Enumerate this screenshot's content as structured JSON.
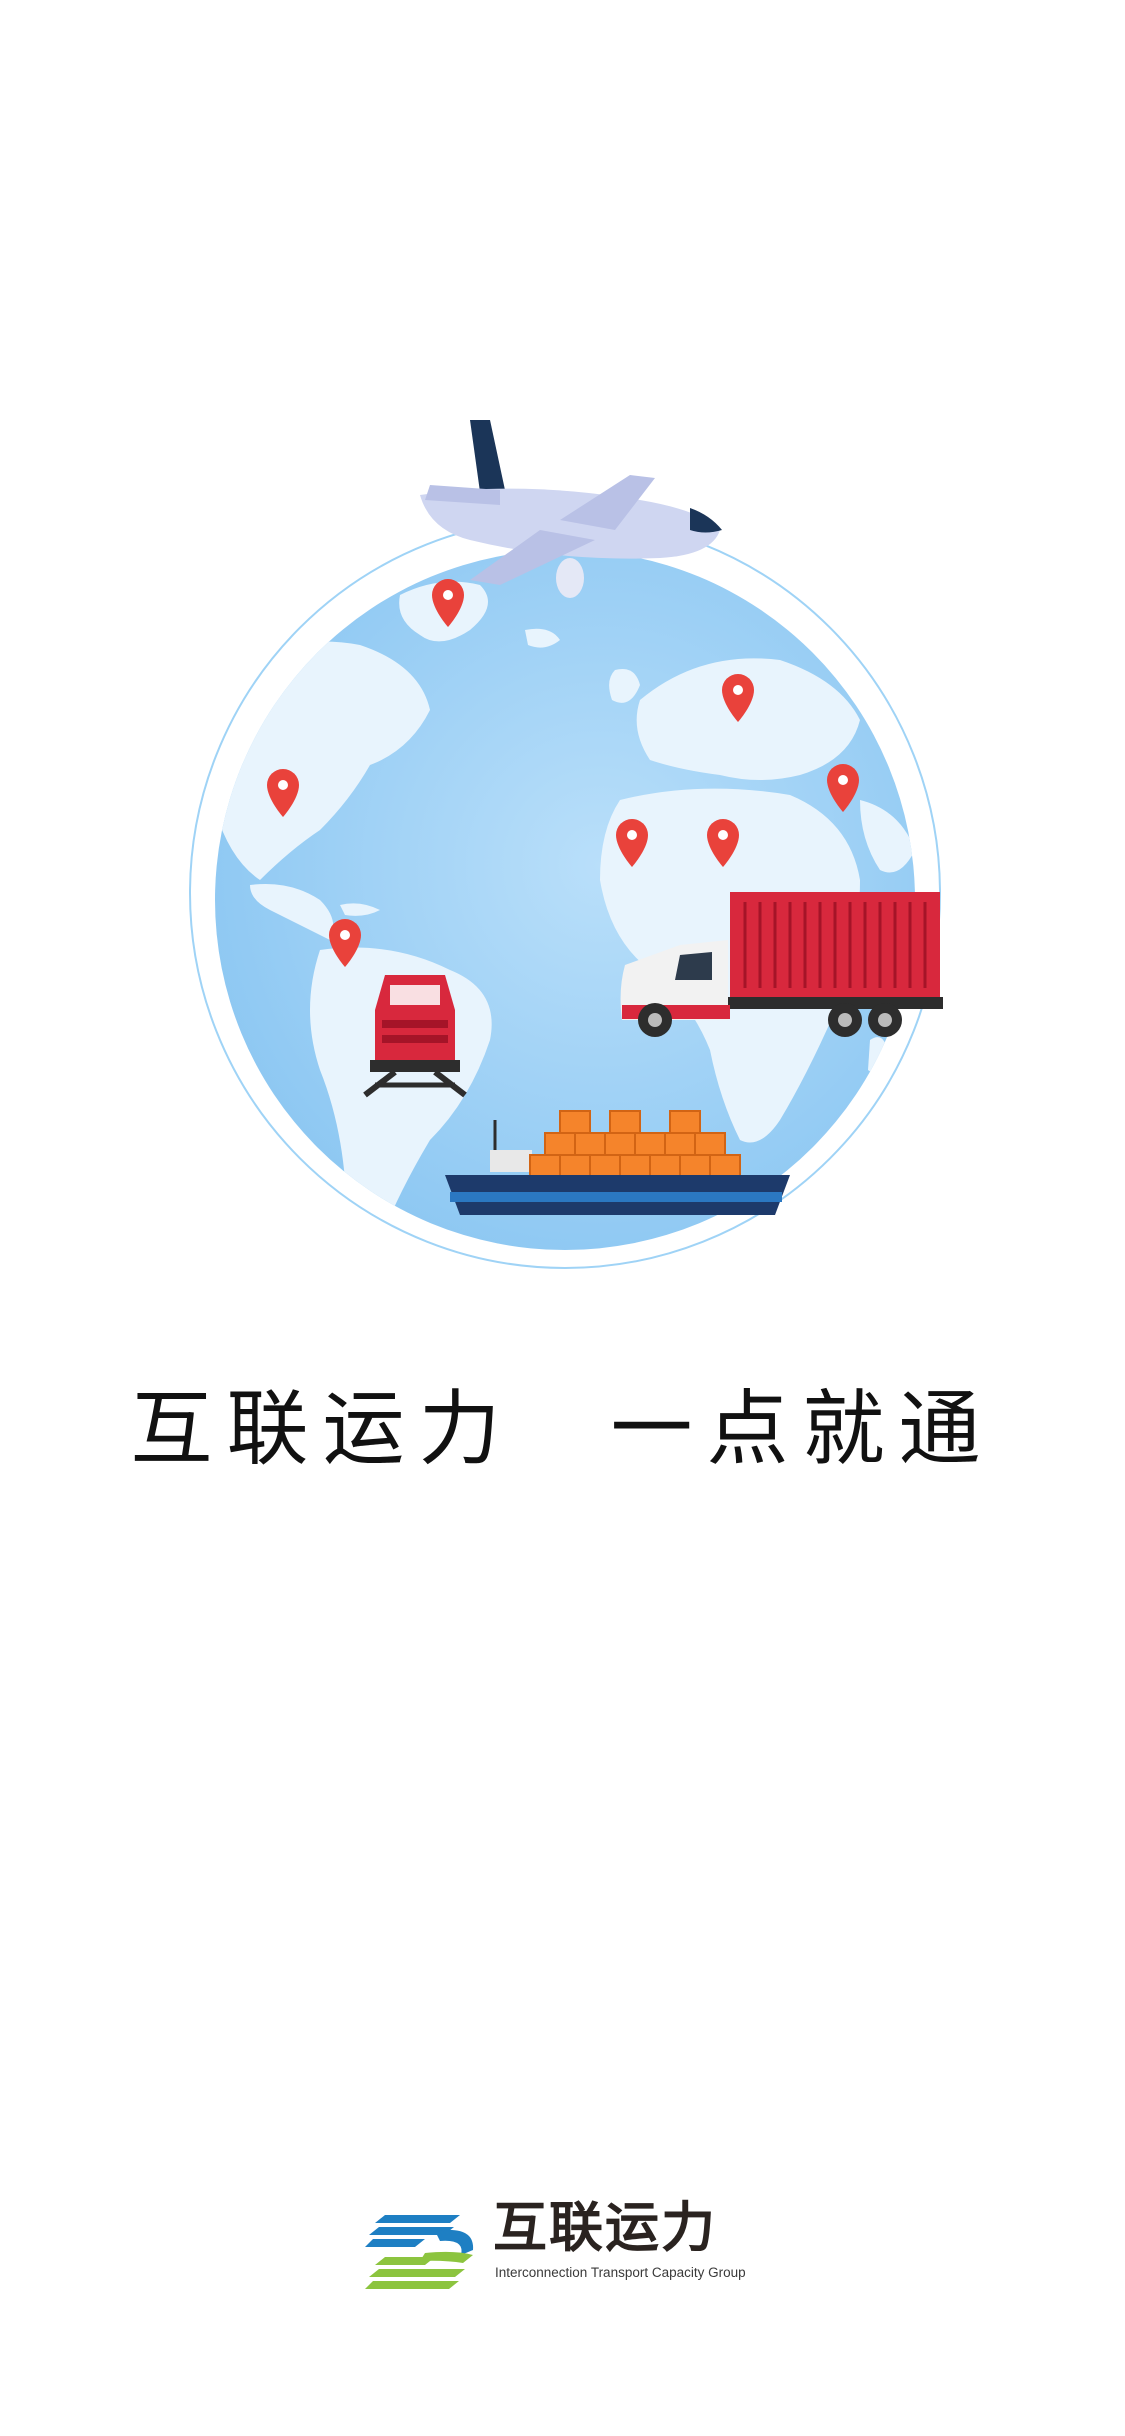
{
  "slogan": "互联运力　一点就通",
  "brand": {
    "name": "互联运力",
    "subtitle": "Interconnection Transport Capacity Group"
  },
  "illustration": {
    "icons": [
      "globe-icon",
      "airplane-icon",
      "truck-icon",
      "train-icon",
      "cargo-ship-icon",
      "location-pin-icon"
    ]
  },
  "colors": {
    "ocean": "#9dd0f5",
    "land": "#e6f3fc",
    "pin": "#e9423b",
    "truck_container": "#d8283d",
    "ship_hull": "#1d3a6b",
    "cargo_boxes": "#f5842b",
    "logo_blue": "#1e7fc3",
    "logo_green": "#8cc43f"
  }
}
